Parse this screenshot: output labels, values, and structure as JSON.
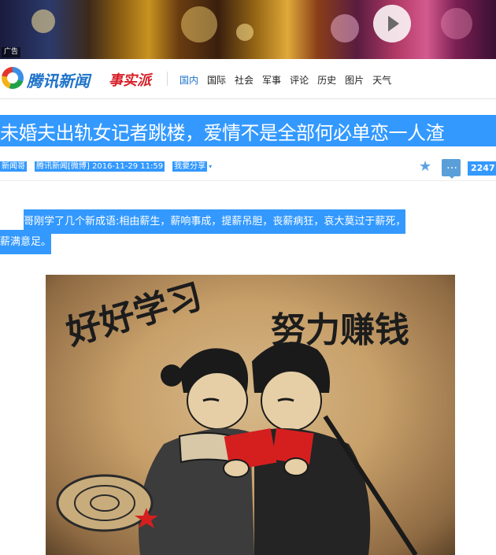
{
  "ad": {
    "tag": "广告"
  },
  "header": {
    "brand": "腾讯新闻",
    "sub_brand": "事实派",
    "nav": [
      "国内",
      "国际",
      "社会",
      "军事",
      "评论",
      "历史",
      "图片",
      "天气"
    ],
    "active_nav": "国内"
  },
  "article": {
    "title": "未婚夫出轨女记者跳楼，爱情不是全部何必单恋一人渣",
    "source": "新闻哥",
    "outlet": "腾讯新闻[微博] 2016-11-29 11:59",
    "share": "我要分享",
    "comment_count": "2247",
    "paragraph_line1": "哥刚学了几个新成语:相由薪生，薪响事成，提薪吊胆，丧薪病狂，哀大莫过于薪死，",
    "paragraph_line2": "薪满意足。"
  },
  "figure": {
    "caption_left": "好好学习",
    "caption_right": "努力赚钱"
  },
  "colors": {
    "selection": "#3399ff",
    "brand_blue": "#1d72c9",
    "brand_red": "#d71e27"
  }
}
